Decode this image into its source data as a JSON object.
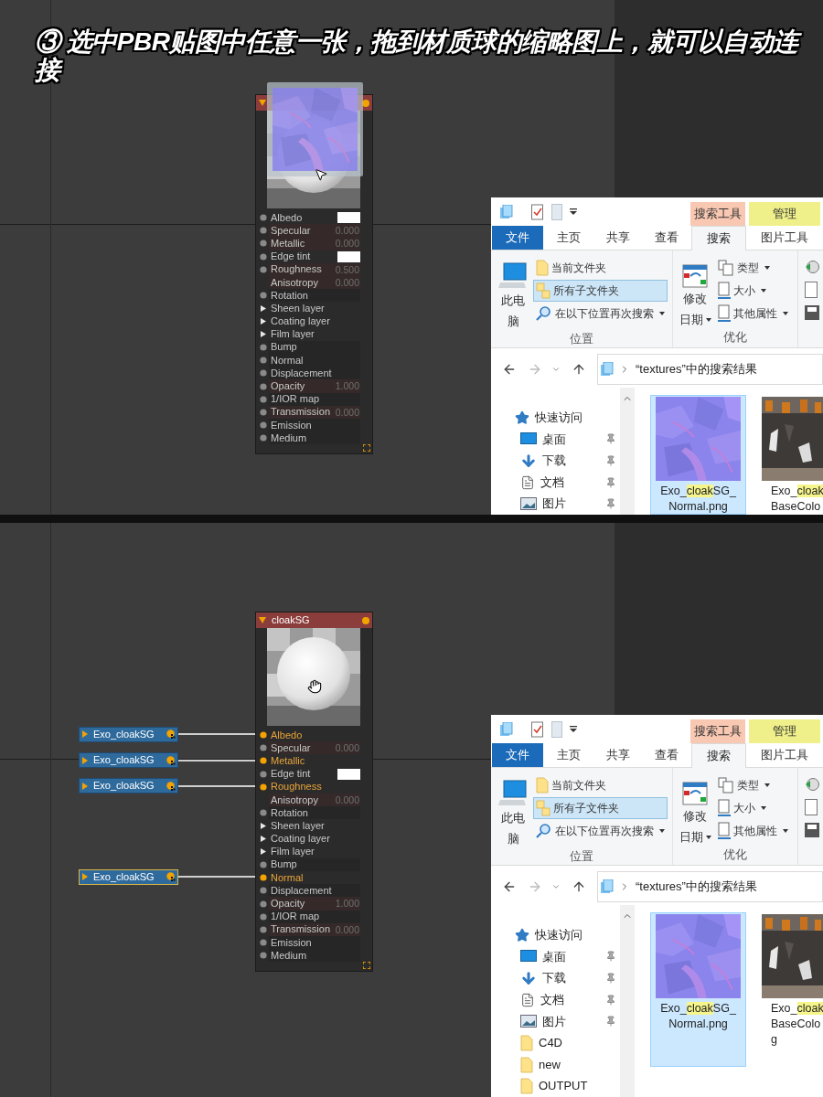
{
  "caption": "③ 选中PBR贴图中任意一张，拖到材质球的缩略图上，就可以自动连接",
  "steps": [
    {
      "drag_preview": true,
      "material_node": {
        "slots": [
          {
            "name": "Albedo",
            "kind": "socket",
            "connected": false,
            "swatch": true
          },
          {
            "name": "Specular",
            "kind": "socket",
            "connected": false,
            "swatch": false,
            "value": "0.000"
          },
          {
            "name": "Metallic",
            "kind": "socket",
            "connected": false,
            "swatch": false,
            "value": "0.000"
          },
          {
            "name": "Edge tint",
            "kind": "socket",
            "connected": false,
            "swatch": true
          },
          {
            "name": "Roughness",
            "kind": "socket",
            "connected": false,
            "swatch": false,
            "value": "0.500"
          },
          {
            "name": "Anisotropy",
            "kind": "parameter",
            "connected": false,
            "swatch": false,
            "value": "0.000"
          },
          {
            "name": "Rotation",
            "kind": "socket",
            "connected": false,
            "swatch": false
          },
          {
            "name": "Sheen layer",
            "kind": "layer",
            "connected": false,
            "swatch": false
          },
          {
            "name": "Coating layer",
            "kind": "layer",
            "connected": false,
            "swatch": false
          },
          {
            "name": "Film layer",
            "kind": "layer",
            "connected": false,
            "swatch": false
          },
          {
            "name": "Bump",
            "kind": "socket",
            "connected": false,
            "swatch": false
          },
          {
            "name": "Normal",
            "kind": "socket",
            "connected": false,
            "swatch": false
          },
          {
            "name": "Displacement",
            "kind": "socket",
            "connected": false,
            "swatch": false
          },
          {
            "name": "Opacity",
            "kind": "socket",
            "connected": false,
            "swatch": false,
            "value": "1.000"
          },
          {
            "name": "1/IOR map",
            "kind": "socket",
            "connected": false,
            "swatch": false
          },
          {
            "name": "Transmission",
            "kind": "socket",
            "connected": false,
            "swatch": false,
            "value": "0.000"
          },
          {
            "name": "Emission",
            "kind": "socket",
            "connected": false,
            "swatch": false
          },
          {
            "name": "Medium",
            "kind": "socket",
            "connected": false,
            "swatch": false
          }
        ]
      },
      "explorer": {
        "context_tabs": [
          {
            "label": "搜索工具",
            "color": "#f9c8b2"
          },
          {
            "label": "管理",
            "color": "#eff08a"
          }
        ],
        "tabs": [
          {
            "label": "文件",
            "kind": "file",
            "selected": false
          },
          {
            "label": "主页",
            "kind": "tab",
            "selected": false
          },
          {
            "label": "共享",
            "kind": "tab",
            "selected": false
          },
          {
            "label": "查看",
            "kind": "tab",
            "selected": false
          },
          {
            "label": "搜索",
            "kind": "tab",
            "selected": true
          },
          {
            "label": "图片工具",
            "kind": "tab",
            "selected": false
          }
        ],
        "ribbon_groups": [
          {
            "label": "位置",
            "big_button": {
              "kind": "computer",
              "lines": [
                "此电",
                "脑"
              ],
              "dropdown": false
            },
            "items": [
              {
                "label": "当前文件夹",
                "kind": "folder",
                "selected": false,
                "dropdown": false
              },
              {
                "label": "所有子文件夹",
                "kind": "subfolders",
                "selected": true,
                "dropdown": false
              },
              {
                "label": "在以下位置再次搜索",
                "kind": "search",
                "selected": false,
                "dropdown": true
              }
            ]
          },
          {
            "label": "优化",
            "big_button": {
              "kind": "calendar",
              "lines": [
                "修改",
                "日期"
              ],
              "dropdown": true
            },
            "items": [
              {
                "label": "类型",
                "kind": "type",
                "selected": false,
                "dropdown": true
              },
              {
                "label": "大小",
                "kind": "size",
                "selected": false,
                "dropdown": true
              },
              {
                "label": "其他属性",
                "kind": "properties",
                "selected": false,
                "dropdown": true
              }
            ]
          }
        ],
        "address": "“textures”中的搜索结果",
        "nav_items": [
          {
            "label": "快速访问",
            "kind": "quick",
            "pinned": false
          },
          {
            "label": "桌面",
            "kind": "desktop",
            "pinned": true
          },
          {
            "label": "下载",
            "kind": "download",
            "pinned": true
          },
          {
            "label": "文档",
            "kind": "document",
            "pinned": true
          },
          {
            "label": "图片",
            "kind": "pictures",
            "pinned": true
          }
        ],
        "files": [
          {
            "kind": "normal_map",
            "selected": true,
            "lines": [
              {
                "text": "Exo_",
                "match": "cloak",
                "rest": "SG_"
              },
              {
                "text": "Normal.png"
              }
            ]
          },
          {
            "kind": "color_map",
            "selected": false,
            "lines": [
              {
                "text": "Exo_",
                "match": "cloak"
              },
              {
                "text": "BaseColo"
              }
            ]
          }
        ]
      }
    },
    {
      "material_node": {
        "title": "cloakSG",
        "slots": [
          {
            "name": "Albedo",
            "kind": "socket",
            "connected": true,
            "swatch": false
          },
          {
            "name": "Specular",
            "kind": "socket",
            "connected": false,
            "swatch": false,
            "value": "0.000"
          },
          {
            "name": "Metallic",
            "kind": "socket",
            "connected": true,
            "swatch": false
          },
          {
            "name": "Edge tint",
            "kind": "socket",
            "connected": false,
            "swatch": true
          },
          {
            "name": "Roughness",
            "kind": "socket",
            "connected": true,
            "swatch": false
          },
          {
            "name": "Anisotropy",
            "kind": "parameter",
            "connected": false,
            "swatch": false,
            "value": "0.000"
          },
          {
            "name": "Rotation",
            "kind": "socket",
            "connected": false,
            "swatch": false
          },
          {
            "name": "Sheen layer",
            "kind": "layer",
            "connected": false,
            "swatch": false
          },
          {
            "name": "Coating layer",
            "kind": "layer",
            "connected": false,
            "swatch": false
          },
          {
            "name": "Film layer",
            "kind": "layer",
            "connected": false,
            "swatch": false
          },
          {
            "name": "Bump",
            "kind": "socket",
            "connected": false,
            "swatch": false
          },
          {
            "name": "Normal",
            "kind": "socket",
            "connected": true,
            "swatch": false
          },
          {
            "name": "Displacement",
            "kind": "socket",
            "connected": false,
            "swatch": false
          },
          {
            "name": "Opacity",
            "kind": "socket",
            "connected": false,
            "swatch": false,
            "value": "1.000"
          },
          {
            "name": "1/IOR map",
            "kind": "socket",
            "connected": false,
            "swatch": false
          },
          {
            "name": "Transmission",
            "kind": "socket",
            "connected": false,
            "swatch": false,
            "value": "0.000"
          },
          {
            "name": "Emission",
            "kind": "socket",
            "connected": false,
            "swatch": false
          },
          {
            "name": "Medium",
            "kind": "socket",
            "connected": false,
            "swatch": false
          }
        ]
      },
      "explorer": {
        "context_tabs": [
          {
            "label": "搜索工具",
            "color": "#f9c8b2"
          },
          {
            "label": "管理",
            "color": "#eff08a"
          }
        ],
        "tabs": [
          {
            "label": "文件",
            "kind": "file",
            "selected": false
          },
          {
            "label": "主页",
            "kind": "tab",
            "selected": false
          },
          {
            "label": "共享",
            "kind": "tab",
            "selected": false
          },
          {
            "label": "查看",
            "kind": "tab",
            "selected": false
          },
          {
            "label": "搜索",
            "kind": "tab",
            "selected": true
          },
          {
            "label": "图片工具",
            "kind": "tab",
            "selected": false
          }
        ],
        "ribbon_groups": [
          {
            "label": "位置",
            "big_button": {
              "kind": "computer",
              "lines": [
                "此电",
                "脑"
              ],
              "dropdown": false
            },
            "items": [
              {
                "label": "当前文件夹",
                "kind": "folder",
                "selected": false,
                "dropdown": false
              },
              {
                "label": "所有子文件夹",
                "kind": "subfolders",
                "selected": true,
                "dropdown": false
              },
              {
                "label": "在以下位置再次搜索",
                "kind": "search",
                "selected": false,
                "dropdown": true
              }
            ]
          },
          {
            "label": "优化",
            "big_button": {
              "kind": "calendar",
              "lines": [
                "修改",
                "日期"
              ],
              "dropdown": true
            },
            "items": [
              {
                "label": "类型",
                "kind": "type",
                "selected": false,
                "dropdown": true
              },
              {
                "label": "大小",
                "kind": "size",
                "selected": false,
                "dropdown": true
              },
              {
                "label": "其他属性",
                "kind": "properties",
                "selected": false,
                "dropdown": true
              }
            ]
          }
        ],
        "address": "“textures”中的搜索结果",
        "nav_items": [
          {
            "label": "快速访问",
            "kind": "quick",
            "pinned": false
          },
          {
            "label": "桌面",
            "kind": "desktop",
            "pinned": true
          },
          {
            "label": "下载",
            "kind": "download",
            "pinned": true
          },
          {
            "label": "文档",
            "kind": "document",
            "pinned": true
          },
          {
            "label": "图片",
            "kind": "pictures",
            "pinned": true
          },
          {
            "label": "C4D",
            "kind": "folder",
            "pinned": false
          },
          {
            "label": "new",
            "kind": "folder",
            "pinned": false
          },
          {
            "label": "OUTPUT",
            "kind": "folder",
            "pinned": false
          }
        ],
        "files": [
          {
            "kind": "normal_map",
            "selected": true,
            "lines": [
              {
                "text": "Exo_",
                "match": "cloak",
                "rest": "SG_"
              },
              {
                "text": "Normal.png"
              }
            ]
          },
          {
            "kind": "color_map",
            "selected": false,
            "lines": [
              {
                "text": "Exo_",
                "match": "cloak"
              },
              {
                "text": "BaseColo"
              },
              {
                "text": "g"
              }
            ]
          }
        ]
      },
      "source_nodes": [
        {
          "label": "Exo_cloakSG",
          "selected": false
        },
        {
          "label": "Exo_cloakSG",
          "selected": false
        },
        {
          "label": "Exo_cloakSG",
          "selected": false
        },
        {
          "label": "Exo_cloakSG",
          "selected": true
        }
      ]
    }
  ]
}
